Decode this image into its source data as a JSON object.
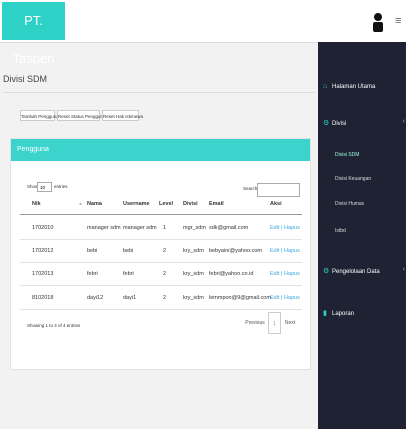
{
  "header": {
    "brand": "PT. Taspen",
    "user_icon": "user-icon",
    "menu_icon": "hamburger-icon",
    "menu_glyph": "≡"
  },
  "sidebar": {
    "items": [
      {
        "label": "Halaman Utama",
        "icon": "home-icon",
        "glyph": "⌂"
      },
      {
        "label": "Divisi",
        "icon": "cogs-icon",
        "glyph": "⚙",
        "arrow": "‹",
        "children": [
          {
            "label": "Divisi SDM"
          },
          {
            "label": "Divisi Keuangan"
          },
          {
            "label": "Divisi Humas"
          },
          {
            "label": "Istbd"
          }
        ]
      },
      {
        "label": "Pengelolaan Data",
        "icon": "cogs-icon",
        "glyph": "⚙",
        "arrow": "‹"
      },
      {
        "label": "Laporan",
        "icon": "file-icon",
        "glyph": "▮"
      }
    ]
  },
  "page": {
    "title": "Divisi SDM"
  },
  "actions": {
    "add_user": "Tambah Pengguna",
    "reset_password": "Reset Status Pengguna",
    "reset_status": "Reset Hak Istimewa"
  },
  "panel": {
    "title": "Pengguna",
    "show_label": "Show",
    "entries_value": "10",
    "entries_label": "entries",
    "search_label": "Search:",
    "columns": [
      "Nik",
      "Nama",
      "Username",
      "Level",
      "Divisi",
      "Email",
      "Aksi"
    ],
    "rows": [
      [
        "1702010",
        "manager sdm",
        "manager sdm",
        "1",
        "mgr_sdm",
        "sdk@gmail.com",
        "Edit | Hapus"
      ],
      [
        "1702012",
        "bebi",
        "bebi",
        "2",
        "kry_sdm",
        "bebyaini@yahoo.com",
        "Edit | Hapus"
      ],
      [
        "1702013",
        "febri",
        "febri",
        "2",
        "kry_sdm",
        "febri@yahoo.co.id",
        "Edit | Hapus"
      ],
      [
        "8102018",
        "dayi12",
        "dayi1",
        "2",
        "kry_sdm",
        "lemmpon@9@gmail.com",
        "Edit | Hapus"
      ]
    ],
    "info": "Showing 1 to 4 of 4 entries",
    "previous": "Previous",
    "current_page": "1",
    "next": "Next"
  }
}
